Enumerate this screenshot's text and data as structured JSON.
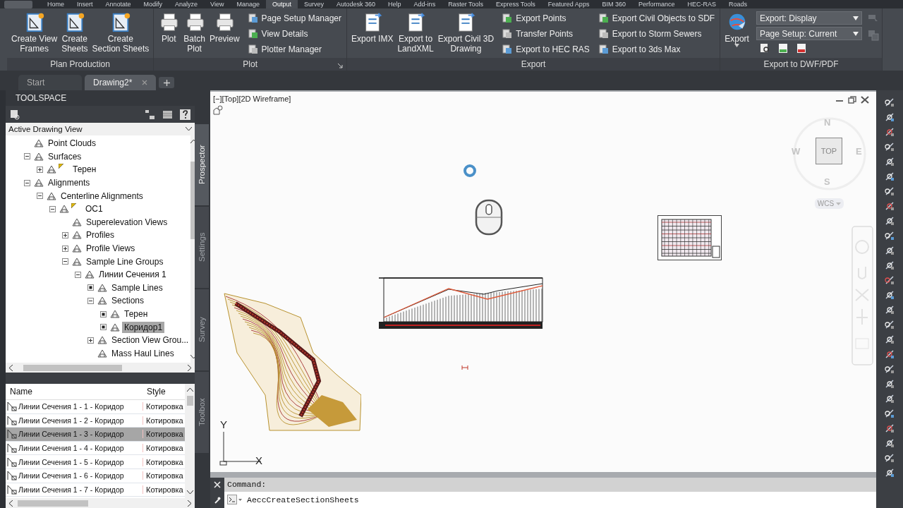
{
  "menu_tabs": [
    {
      "label": "Home",
      "selected": false
    },
    {
      "label": "Insert",
      "selected": false
    },
    {
      "label": "Annotate",
      "selected": false
    },
    {
      "label": "Modify",
      "selected": false
    },
    {
      "label": "Analyze",
      "selected": false
    },
    {
      "label": "View",
      "selected": false
    },
    {
      "label": "Manage",
      "selected": false
    },
    {
      "label": "Output",
      "selected": true
    },
    {
      "label": "Survey",
      "selected": false
    },
    {
      "label": "Autodesk 360",
      "selected": false
    },
    {
      "label": "Help",
      "selected": false
    },
    {
      "label": "Add-ins",
      "selected": false
    },
    {
      "label": "Raster Tools",
      "selected": false
    },
    {
      "label": "Express Tools",
      "selected": false
    },
    {
      "label": "Featured Apps",
      "selected": false
    },
    {
      "label": "BIM 360",
      "selected": false
    },
    {
      "label": "Performance",
      "selected": false
    },
    {
      "label": "HEC-RAS",
      "selected": false
    },
    {
      "label": "Roads",
      "selected": false
    }
  ],
  "ribbon": {
    "panels": [
      {
        "title": "Plan Production",
        "launcher": false,
        "large_tools": [
          {
            "lines": [
              "Create View",
              "Frames"
            ],
            "dropdown": false
          },
          {
            "lines": [
              "Create",
              "Sheets"
            ],
            "dropdown": false
          },
          {
            "lines": [
              "Create",
              "Section Sheets"
            ],
            "dropdown": false
          }
        ]
      },
      {
        "title": "Plot",
        "launcher": true,
        "large_tools": [
          {
            "lines": [
              "Plot"
            ],
            "dropdown": false
          },
          {
            "lines": [
              "Batch",
              "Plot"
            ],
            "dropdown": false
          },
          {
            "lines": [
              "Preview"
            ],
            "dropdown": false
          }
        ],
        "small_columns": [
          [
            "Page Setup Manager",
            "View Details",
            "Plotter Manager"
          ]
        ]
      },
      {
        "title": "Export",
        "launcher": false,
        "large_tools": [
          {
            "lines": [
              "Export IMX"
            ],
            "dropdown": false
          },
          {
            "lines": [
              "Export to",
              "LandXML"
            ],
            "dropdown": false
          },
          {
            "lines": [
              "Export Civil 3D",
              "Drawing"
            ],
            "dropdown": false
          }
        ],
        "small_columns": [
          [
            "Export Points",
            "Transfer Points",
            "Export to HEC RAS"
          ],
          [
            "Export Civil Objects to SDF",
            "Export to Storm Sewers",
            "Export to 3ds Max"
          ]
        ]
      },
      {
        "title": "Export to DWF/PDF",
        "launcher": false,
        "large_tools": [
          {
            "lines": [
              "Export"
            ],
            "dropdown": true
          }
        ],
        "dropdowns": [
          "Export: Display",
          "Page Setup: Current"
        ]
      }
    ]
  },
  "doc_tabs": [
    {
      "label": "Start",
      "selected": false,
      "closable": false
    },
    {
      "label": "Drawing2*",
      "selected": true,
      "closable": true
    }
  ],
  "toolspace": {
    "title": "TOOLSPACE",
    "view_selector": "Active Drawing View",
    "side_tabs": [
      {
        "label": "Prospector",
        "selected": true
      },
      {
        "label": "Settings",
        "selected": false
      },
      {
        "label": "Survey",
        "selected": false
      },
      {
        "label": "Toolbox",
        "selected": false
      }
    ],
    "tree": [
      {
        "label": "Point Clouds",
        "kind": "leaf",
        "selected": false
      },
      {
        "label": "Surfaces",
        "kind": "folder",
        "expanded": true,
        "selected": false,
        "children": [
          {
            "label": "Терен",
            "kind": "folder",
            "expanded": false,
            "flag": true,
            "selected": false
          }
        ]
      },
      {
        "label": "Alignments",
        "kind": "folder",
        "expanded": true,
        "selected": false,
        "children": [
          {
            "label": "Centerline Alignments",
            "kind": "folder",
            "expanded": true,
            "selected": false,
            "children": [
              {
                "label": "OC1",
                "kind": "folder",
                "expanded": true,
                "flag": true,
                "selected": false,
                "children": [
                  {
                    "label": "Superelevation Views",
                    "kind": "leaf",
                    "selected": false
                  },
                  {
                    "label": "Profiles",
                    "kind": "folder",
                    "expanded": false,
                    "selected": false
                  },
                  {
                    "label": "Profile Views",
                    "kind": "folder",
                    "expanded": false,
                    "selected": false
                  },
                  {
                    "label": "Sample Line Groups",
                    "kind": "folder",
                    "expanded": true,
                    "selected": false,
                    "children": [
                      {
                        "label": "Линии Сечения 1",
                        "kind": "folder",
                        "expanded": true,
                        "selected": false,
                        "children": [
                          {
                            "label": "Sample Lines",
                            "kind": "dot",
                            "selected": false
                          },
                          {
                            "label": "Sections",
                            "kind": "folder",
                            "expanded": true,
                            "selected": false,
                            "children": [
                              {
                                "label": "Терен",
                                "kind": "dot",
                                "selected": false
                              },
                              {
                                "label": "Коридор1",
                                "kind": "dot",
                                "selected": true
                              }
                            ]
                          },
                          {
                            "label": "Section View Grou...",
                            "kind": "folder",
                            "expanded": false,
                            "selected": false
                          },
                          {
                            "label": "Mass Haul Lines",
                            "kind": "leaf",
                            "selected": false
                          }
                        ]
                      }
                    ]
                  }
                ]
              }
            ]
          }
        ]
      }
    ],
    "items_table": {
      "columns": [
        "Name",
        "Style"
      ],
      "rows": [
        {
          "name": "Линии Сечения 1 - 1 - Коридор",
          "style": "Котировка",
          "selected": false
        },
        {
          "name": "Линии Сечения 1 - 2 - Коридор",
          "style": "Котировка",
          "selected": false
        },
        {
          "name": "Линии Сечения 1 - 3 - Коридор",
          "style": "Котировка",
          "selected": true
        },
        {
          "name": "Линии Сечения 1 - 4 - Коридор",
          "style": "Котировка",
          "selected": false
        },
        {
          "name": "Линии Сечения 1 - 5 - Коридор",
          "style": "Котировка",
          "selected": false
        },
        {
          "name": "Линии Сечения 1 - 6 - Коридор",
          "style": "Котировка",
          "selected": false
        },
        {
          "name": "Линии Сечения 1 - 7 - Коридор",
          "style": "Котировка",
          "selected": false
        }
      ]
    }
  },
  "viewport": {
    "label": "[−][Top][2D Wireframe]",
    "view_cube": {
      "north": "N",
      "west": "W",
      "face": "TOP",
      "east": "E",
      "south": "S",
      "ucs": "WCS"
    },
    "ucs_axes": {
      "x": "X",
      "y": "Y"
    }
  },
  "command_line": {
    "prompt": "Command:",
    "input": "AeccCreateSectionSheets"
  }
}
